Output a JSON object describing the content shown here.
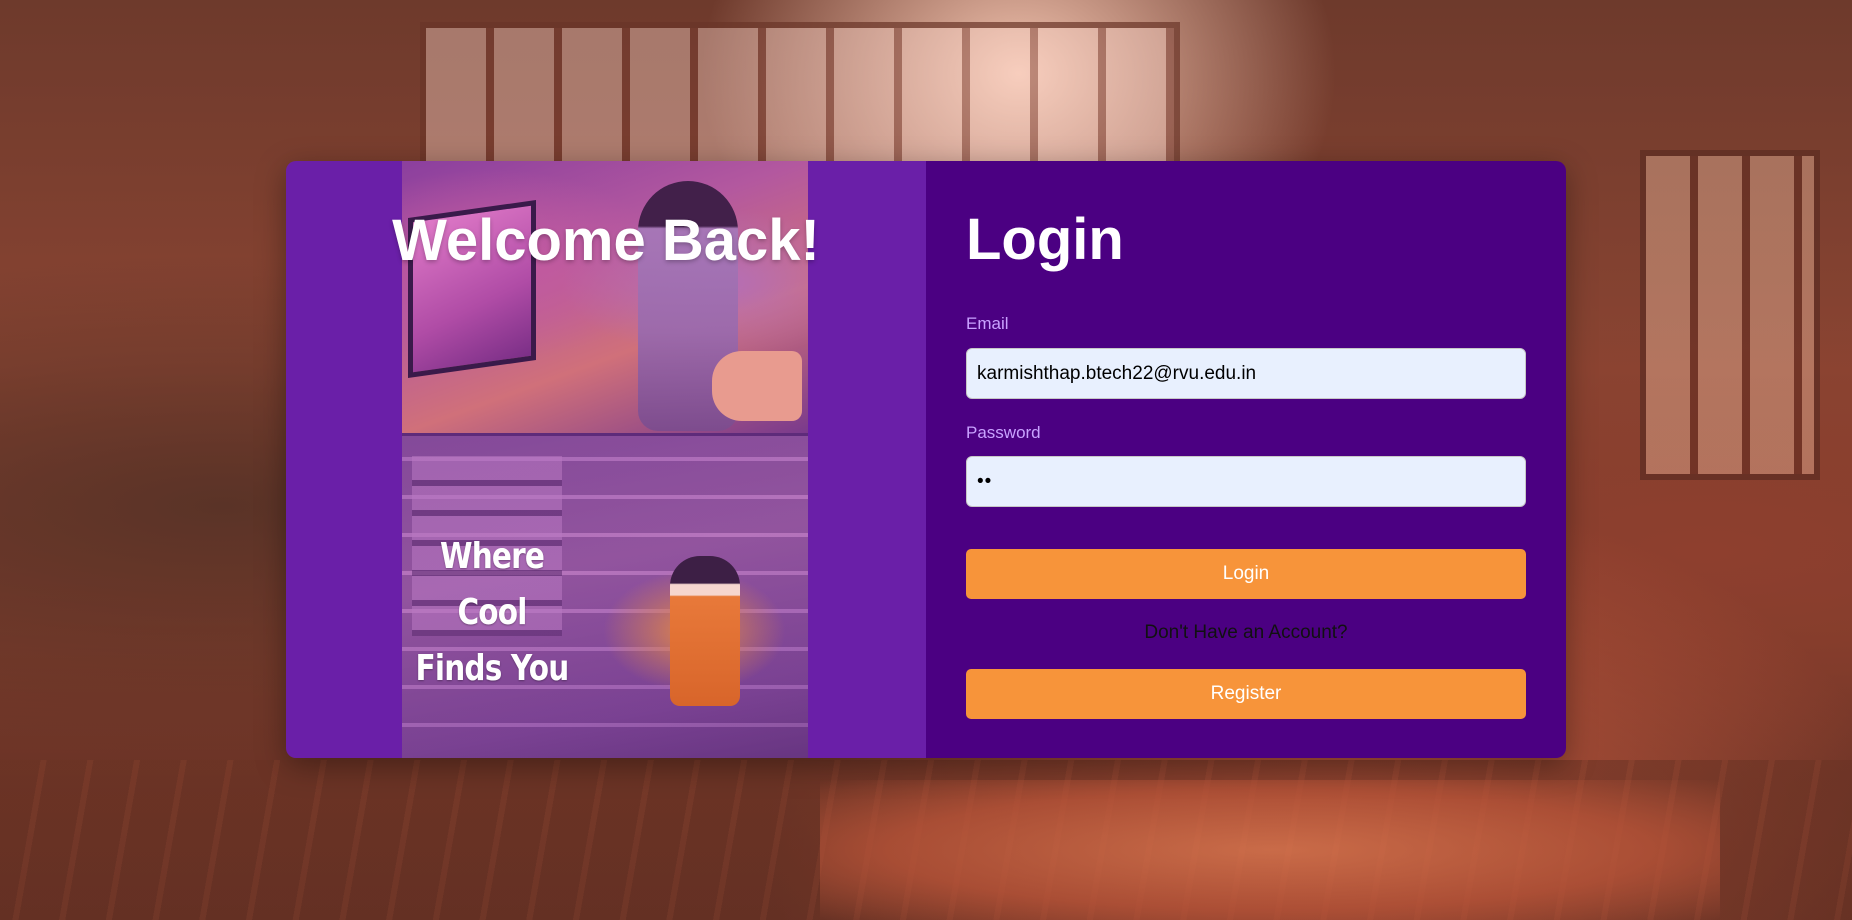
{
  "left_panel": {
    "welcome_title": "Welcome Back!",
    "tagline": "Where Cool Finds You"
  },
  "login_form": {
    "title": "Login",
    "email_label": "Email",
    "email_value": "karmishthap.btech22@rvu.edu.in",
    "password_label": "Password",
    "password_value": "ab",
    "login_button": "Login",
    "account_prompt": "Don't Have an Account?",
    "register_button": "Register"
  },
  "colors": {
    "left_panel_bg": "#6a1fa8",
    "right_panel_bg": "#4b0082",
    "button_bg": "#f7943a",
    "label_color": "#c9a2ff",
    "input_bg": "#e8f0fe"
  }
}
